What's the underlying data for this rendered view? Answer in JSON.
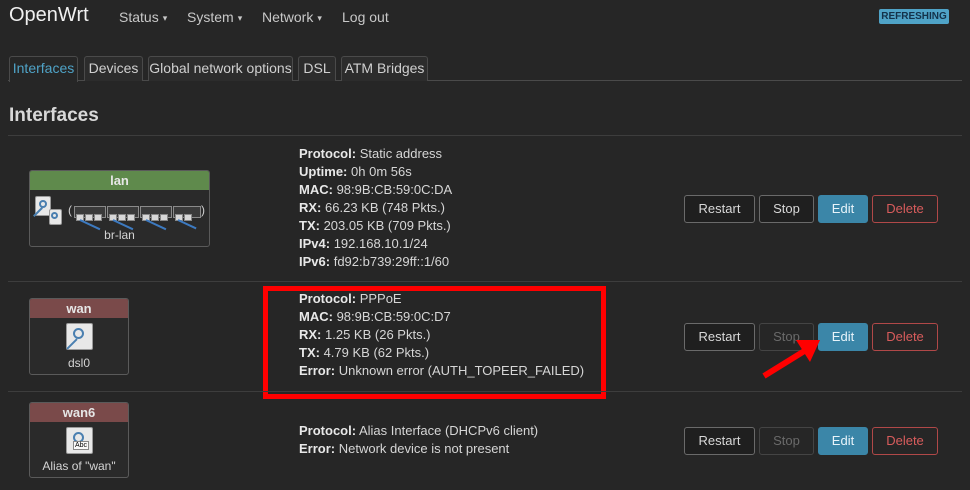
{
  "navbar": {
    "brand": "OpenWrt",
    "menus": [
      {
        "label": "Status",
        "caret": "▾"
      },
      {
        "label": "System",
        "caret": "▾"
      },
      {
        "label": "Network",
        "caret": "▾"
      },
      {
        "label": "Log out",
        "caret": ""
      }
    ],
    "status_badge": "REFRESHING",
    "badge_color": "#4fa3c7"
  },
  "tabs": [
    {
      "label": "Interfaces",
      "active": true
    },
    {
      "label": "Devices",
      "active": false
    },
    {
      "label": "Global network options",
      "active": false
    },
    {
      "label": "DSL",
      "active": false
    },
    {
      "label": "ATM Bridges",
      "active": false
    }
  ],
  "section_title": "Interfaces",
  "interfaces": [
    {
      "name": "lan",
      "device_label": "br-lan",
      "details": [
        {
          "k": "Protocol:",
          "v": "Static address"
        },
        {
          "k": "Uptime:",
          "v": "0h 0m 56s"
        },
        {
          "k": "MAC:",
          "v": "98:9B:CB:59:0C:DA"
        },
        {
          "k": "RX:",
          "v": "66.23 KB (748 Pkts.)"
        },
        {
          "k": "TX:",
          "v": "203.05 KB (709 Pkts.)"
        },
        {
          "k": "IPv4:",
          "v": "192.168.10.1/24"
        },
        {
          "k": "IPv6:",
          "v": "fd92:b739:29ff::1/60"
        }
      ],
      "stop_enabled": true
    },
    {
      "name": "wan",
      "device_label": "dsl0",
      "details": [
        {
          "k": "Protocol:",
          "v": "PPPoE"
        },
        {
          "k": "MAC:",
          "v": "98:9B:CB:59:0C:D7"
        },
        {
          "k": "RX:",
          "v": "1.25 KB (26 Pkts.)"
        },
        {
          "k": "TX:",
          "v": "4.79 KB (62 Pkts.)"
        },
        {
          "k": "Error:",
          "v": "Unknown error (AUTH_TOPEER_FAILED)"
        }
      ],
      "stop_enabled": false
    },
    {
      "name": "wan6",
      "device_label": "Alias of \"wan\"",
      "abc_label": "Abc",
      "details": [
        {
          "k": "Protocol:",
          "v": "Alias Interface (DHCPv6 client)"
        },
        {
          "k": "Error:",
          "v": "Network device is not present"
        }
      ],
      "stop_enabled": false
    }
  ],
  "buttons": {
    "restart": "Restart",
    "stop": "Stop",
    "edit": "Edit",
    "delete": "Delete"
  },
  "colors": {
    "accent": "#3b86a8",
    "danger": "#d85c5c",
    "lan_header": "#5f8a4c",
    "wan_header": "#7a4a4a",
    "annotation": "#ff0000"
  }
}
